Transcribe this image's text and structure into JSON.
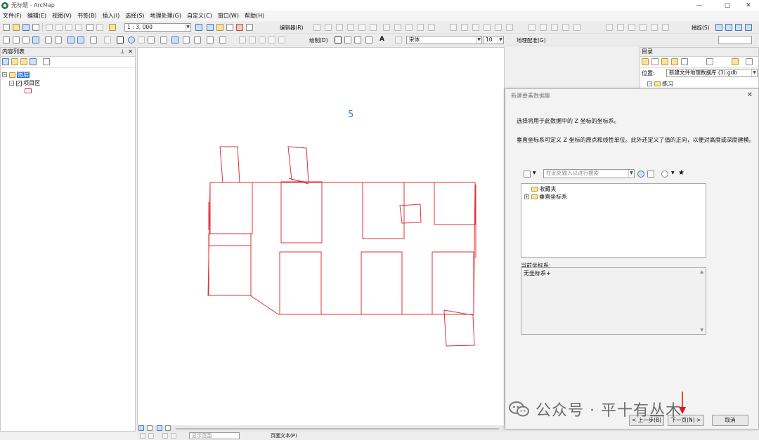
{
  "window": {
    "title": "无标题 - ArcMap",
    "controls": [
      "—",
      "▢",
      "✕"
    ]
  },
  "menu": [
    "文件(F)",
    "编辑(E)",
    "视图(V)",
    "书签(B)",
    "插入(I)",
    "选择(S)",
    "地理处理(G)",
    "自定义(C)",
    "窗口(W)",
    "帮助(H)"
  ],
  "toolbars": {
    "scale": "1 : 3, 000",
    "editor_label": "编辑器(R)",
    "draw_label": "绘制(D)",
    "font": "宋体",
    "font_size": "10",
    "georef_label": "地理配准(G)",
    "snap_label": "捕捉(S)"
  },
  "toc": {
    "title": "内容列表",
    "layers_label": "图层",
    "layer_name": "项目区"
  },
  "catalog": {
    "title": "目录",
    "location_label": "位置:",
    "location_value": "新建文件地理数据库 (3).gdb",
    "item": "练习"
  },
  "map": {
    "label": "5"
  },
  "dialog": {
    "title": "新建要素数据集",
    "instruction": "选择将用于此数据中的 Z 坐标的坐标系。",
    "description": "垂直坐标系可定义 Z 坐标的原点和线性单位。此外还定义了值的正向，以便对高度或深度建模。",
    "search_placeholder": "在此处输入以进行搜索",
    "tree": [
      "收藏夹",
      "垂直坐标系"
    ],
    "current_label": "当前坐标系:",
    "current_value": "无坐标系+",
    "buttons": {
      "back": "< 上一步(B)",
      "next": "下一页(N) >",
      "cancel": "取消"
    }
  },
  "status": {
    "display_label": "显示范围",
    "text_label": "页面文本(P)"
  },
  "watermark": "公众号 · 平十有丛木",
  "colors": {
    "feature_outline": "#e0303a",
    "label_blue": "#2f7fd6",
    "arrow_red": "#e01818"
  }
}
